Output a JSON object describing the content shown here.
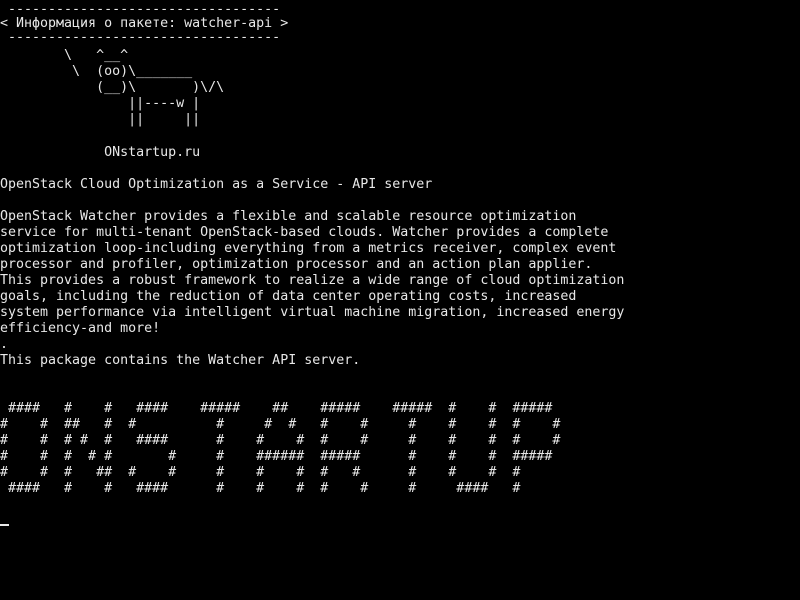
{
  "terminal": {
    "header_rule_top": " ----------------------------------",
    "header_title": "< Информация о пакете: watcher-api >",
    "header_rule_bottom": " ----------------------------------",
    "cow_art": [
      "        \\   ^__^",
      "         \\  (oo)\\_______",
      "            (__)\\       )\\/\\",
      "                ||----w |",
      "                ||     ||"
    ],
    "site": "             ONstartup.ru",
    "summary": "OpenStack Cloud Optimization as a Service - API server",
    "description": [
      "OpenStack Watcher provides a flexible and scalable resource optimization",
      "service for multi-tenant OpenStack-based clouds. Watcher provides a complete",
      "optimization loop-including everything from a metrics receiver, complex event",
      "processor and profiler, optimization processor and an action plan applier.",
      "This provides a robust framework to realize a wide range of cloud optimization",
      "goals, including the reduction of data center operating costs, increased",
      "system performance via intelligent virtual machine migration, increased energy",
      "efficiency-and more!",
      "."
    ],
    "package_note": "This package contains the Watcher API server.",
    "banner": [
      " ####   #    #   ####    #####    ##    #####    #####  #    #  #####",
      "#    #  ##   #  #          #     #  #   #    #     #    #    #  #    #",
      "#    #  # #  #   ####      #    #    #  #    #     #    #    #  #    #",
      "#    #  #  # #       #     #    ######  #####      #    #    #  #####",
      "#    #  #   ##  #    #     #    #    #  #   #      #    #    #  #",
      " ####   #    #   ####      #    #    #  #    #     #     ####   #"
    ],
    "text_color": "#e8e8e8",
    "background_color": "#000000"
  }
}
